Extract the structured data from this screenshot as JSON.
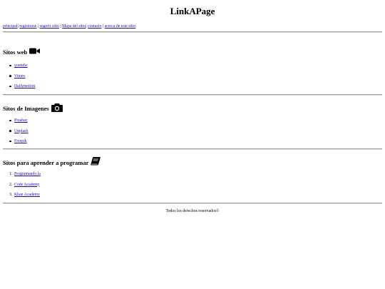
{
  "header": {
    "title": "LinkAPage"
  },
  "nav": {
    "items": [
      {
        "label": "principal"
      },
      {
        "label": "registrarse"
      },
      {
        "label": "sugerir sitio"
      },
      {
        "label": "Mapa del sitio"
      },
      {
        "label": "contacto"
      },
      {
        "label": "acerca de este sitio"
      }
    ],
    "separator": "|"
  },
  "sections": [
    {
      "title": "Sitos web",
      "icon": "video-camera-icon",
      "links": [
        {
          "label": "youtube"
        },
        {
          "label": "Vimeo"
        },
        {
          "label": "Dailymotion"
        }
      ]
    },
    {
      "title": "Sitos de Imagenes",
      "icon": "camera-icon",
      "links": [
        {
          "label": "Pixabay"
        },
        {
          "label": "Unplash"
        },
        {
          "label": "Freepik"
        }
      ]
    },
    {
      "title": "Sitos para aprender a programar",
      "icon": "book-icon",
      "links": [
        {
          "num": "1.",
          "label": "Programando.la"
        },
        {
          "num": "2.",
          "label": "Code Academy"
        },
        {
          "num": "3.",
          "label": "Khan Academy"
        }
      ]
    }
  ],
  "footer": {
    "text": "Todos los derechos reservados©"
  }
}
